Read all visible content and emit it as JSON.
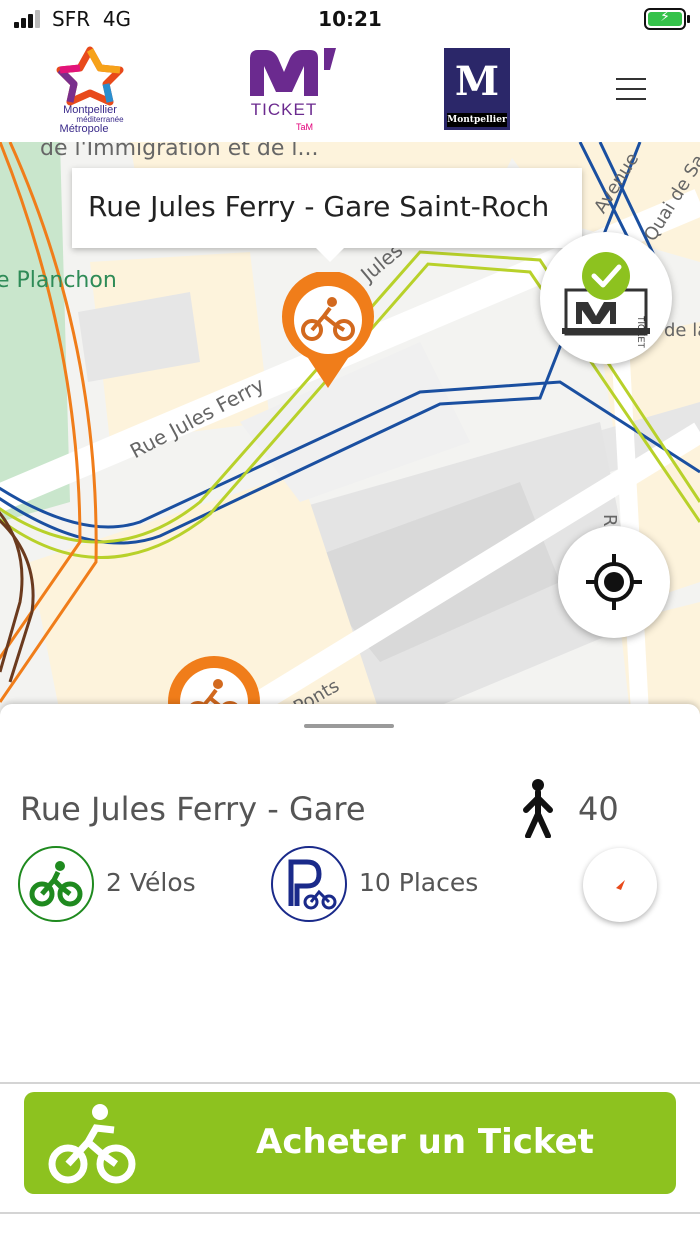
{
  "status_bar": {
    "carrier": "SFR",
    "network": "4G",
    "time": "10:21",
    "battery_color": "#35c24a"
  },
  "header": {
    "logo_metropole": {
      "line1": "Montpellier",
      "line2": "méditerranée",
      "line3": "Métropole"
    },
    "logo_mticket": {
      "text": "TICKET",
      "sub": "TaM"
    },
    "logo_montpellier": {
      "letter": "M",
      "word": "Montpellier"
    },
    "menu_icon": "hamburger-icon"
  },
  "map": {
    "labels": {
      "top_street": "de l'Immigration et de l...",
      "park": "e Planchon",
      "street_jules_ferry": "Rue Jules Ferry",
      "street_jules_top": "Jules",
      "avenue": "Avenue",
      "quai": "Quai de Sa",
      "de_la": "de la",
      "ru": "Ru",
      "ponts": "Ponts"
    },
    "callout_title": "Rue Jules Ferry - Gare Saint-Roch",
    "pin_color": "#f07d1a",
    "ticket_fab_icon": "mticket-validated-icon",
    "ticket_fab_label": "TICKET",
    "locate_icon": "crosshair-icon"
  },
  "sheet": {
    "station_name": "Rue Jules Ferry - Gare",
    "walk_minutes": "40",
    "bikes": "2 Vélos",
    "places": "10 Places",
    "buy_button": "Acheter un Ticket",
    "buy_color": "#8dc21f",
    "bike_color": "#1f8a1f",
    "park_color": "#1a2a8a"
  }
}
